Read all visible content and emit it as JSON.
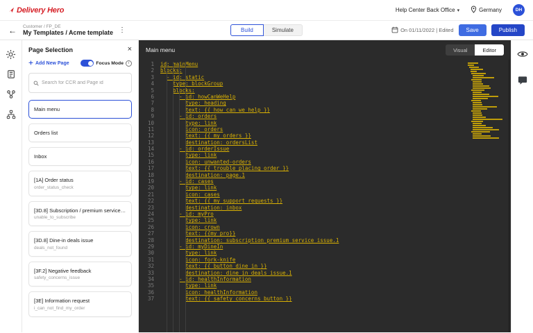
{
  "topbar": {
    "logo": "Delivery Hero",
    "app_title": "Help Center Back Office",
    "country": "Germany",
    "avatar_initials": "DH"
  },
  "header": {
    "breadcrumb": "Customer / FP_DE",
    "title": "My Templates / Acme template",
    "build_label": "Build",
    "simulate_label": "Simulate",
    "edited_status": "On 01/11/2022 | Edited",
    "save_label": "Save",
    "publish_label": "Publish"
  },
  "icons": {
    "back": "←",
    "kebab": "⋮",
    "close": "×",
    "chevron_down": "▾"
  },
  "panel": {
    "title": "Page Selection",
    "add_new_page": "Add New Page",
    "focus_mode": "Focus Mode",
    "search_placeholder": "Search for CCR and Page id",
    "pages": [
      {
        "label": "Main menu",
        "sub": "",
        "selected": true
      },
      {
        "label": "Orders list",
        "sub": "",
        "selected": false
      },
      {
        "label": "Inbox",
        "sub": "",
        "selected": false
      },
      {
        "label": "[1A] Order status",
        "sub": "order_status_check",
        "selected": false
      },
      {
        "label": "[3D.8] Subscription / premium service is...",
        "sub": "unable_to_subscribe",
        "selected": false
      },
      {
        "label": "[3D.8] Dine-in deals issue",
        "sub": "deals_not_found",
        "selected": false
      },
      {
        "label": "[3F.2] Negative feedback",
        "sub": "safety_concerns_issue",
        "selected": false
      },
      {
        "label": "[3E] Information request",
        "sub": "i_can_not_find_my_order",
        "selected": false
      }
    ]
  },
  "editor": {
    "title": "Main menu",
    "mode_visual": "Visual",
    "mode_editor": "Editor",
    "code_lines": [
      "id: mainMenu",
      "blocks:",
      "  - id: static",
      "    type: blockGroup",
      "    blocks:",
      "      - id: howCanWeHelp",
      "        type: heading",
      "        text: {{ how_can_we_help }}",
      "      - id: orders",
      "        type: link",
      "        icon: orders",
      "        text: {{ my_orders }}",
      "        destination: ordersList",
      "      - id: orderIssue",
      "        type: link",
      "        icon: unwanted-orders",
      "        text: {{ trouble_placing_order }}",
      "        destination: page.1",
      "      - id: cases",
      "        type: link",
      "        icon: cases",
      "        text: {{ my_support_requests }}",
      "        destination: inbox",
      "      - id: myPro",
      "        type: link",
      "        icon: crown",
      "        text: {{my_pro}}",
      "        destination: subscription_premium_service_issue.1",
      "      - id: myDineIn",
      "        type: link",
      "        icon: fork-knife",
      "        text: {{ button_dine_in }}",
      "        destination: dine_in_deals_issue.1",
      "      - id: healthInformation",
      "        type: link",
      "        icon: healthInformation",
      "        text: {{ safety_concerns_button }}"
    ]
  },
  "colors": {
    "accent_blue": "#2c51d8",
    "logo_red": "#d61f26",
    "editor_bg": "#2b2b2b",
    "code_yellow": "#d9b104"
  }
}
